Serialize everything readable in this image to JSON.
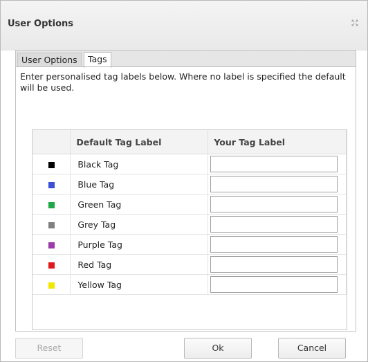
{
  "dialog": {
    "title": "User Options",
    "close_glyph": "⌖"
  },
  "tabs": [
    {
      "label": "User Options",
      "active": false
    },
    {
      "label": "Tags",
      "active": true
    }
  ],
  "instructions": "Enter personalised tag labels below. Where no label is specified the default will be used.",
  "table": {
    "headers": [
      "",
      "Default Tag Label",
      "Your Tag Label"
    ],
    "rows": [
      {
        "label": "Black Tag",
        "color": "#000000",
        "value": ""
      },
      {
        "label": "Blue Tag",
        "color": "#3c4fd6",
        "value": ""
      },
      {
        "label": "Green Tag",
        "color": "#1fa84a",
        "value": ""
      },
      {
        "label": "Grey Tag",
        "color": "#808080",
        "value": ""
      },
      {
        "label": "Purple Tag",
        "color": "#9b3aa8",
        "value": ""
      },
      {
        "label": "Red Tag",
        "color": "#e0191c",
        "value": ""
      },
      {
        "label": "Yellow Tag",
        "color": "#f2e600",
        "value": ""
      }
    ]
  },
  "buttons": {
    "reset": "Reset",
    "ok": "Ok",
    "cancel": "Cancel"
  }
}
